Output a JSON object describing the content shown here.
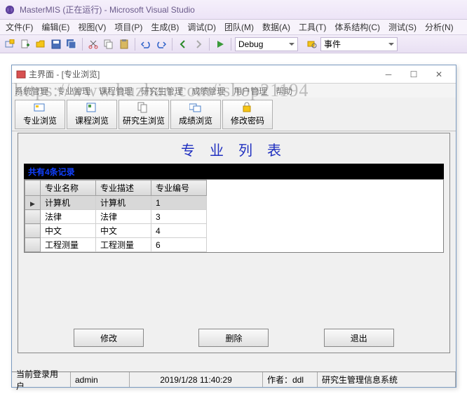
{
  "vs": {
    "title": "MasterMIS (正在运行) - Microsoft Visual Studio",
    "menu": [
      "文件(F)",
      "编辑(E)",
      "视图(V)",
      "项目(P)",
      "生成(B)",
      "调试(D)",
      "团队(M)",
      "数据(A)",
      "工具(T)",
      "体系结构(C)",
      "测试(S)",
      "分析(N)"
    ],
    "config": "Debug",
    "events": "事件"
  },
  "app": {
    "title": "主界面 - [专业浏览]",
    "menu": [
      "系统管理",
      "专业管理",
      "课程管理",
      "研究生管理",
      "成绩管理",
      "用户管理",
      "帮助"
    ],
    "toolbar": [
      {
        "label": "专业浏览"
      },
      {
        "label": "课程浏览"
      },
      {
        "label": "研究生浏览"
      },
      {
        "label": "成绩浏览"
      },
      {
        "label": "修改密码"
      }
    ]
  },
  "page": {
    "heading": "专 业 列 表",
    "countText": "共有4条记录",
    "columns": [
      "专业名称",
      "专业描述",
      "专业编号"
    ],
    "rows": [
      {
        "name": "计算机",
        "desc": "计算机",
        "id": "1",
        "sel": true
      },
      {
        "name": "法律",
        "desc": "法律",
        "id": "3",
        "sel": false
      },
      {
        "name": "中文",
        "desc": "中文",
        "id": "4",
        "sel": false
      },
      {
        "name": "工程测量",
        "desc": "工程测量",
        "id": "6",
        "sel": false
      }
    ],
    "buttons": {
      "edit": "修改",
      "delete": "删除",
      "exit": "退出"
    }
  },
  "status": {
    "userLabel": "当前登录用户",
    "user": "admin",
    "time": "2019/1/28 11:40:29",
    "authorLabel": "作者：ddl",
    "system": "研究生管理信息系统"
  },
  "watermark": "https://www.huzhan.com/ishop21194"
}
